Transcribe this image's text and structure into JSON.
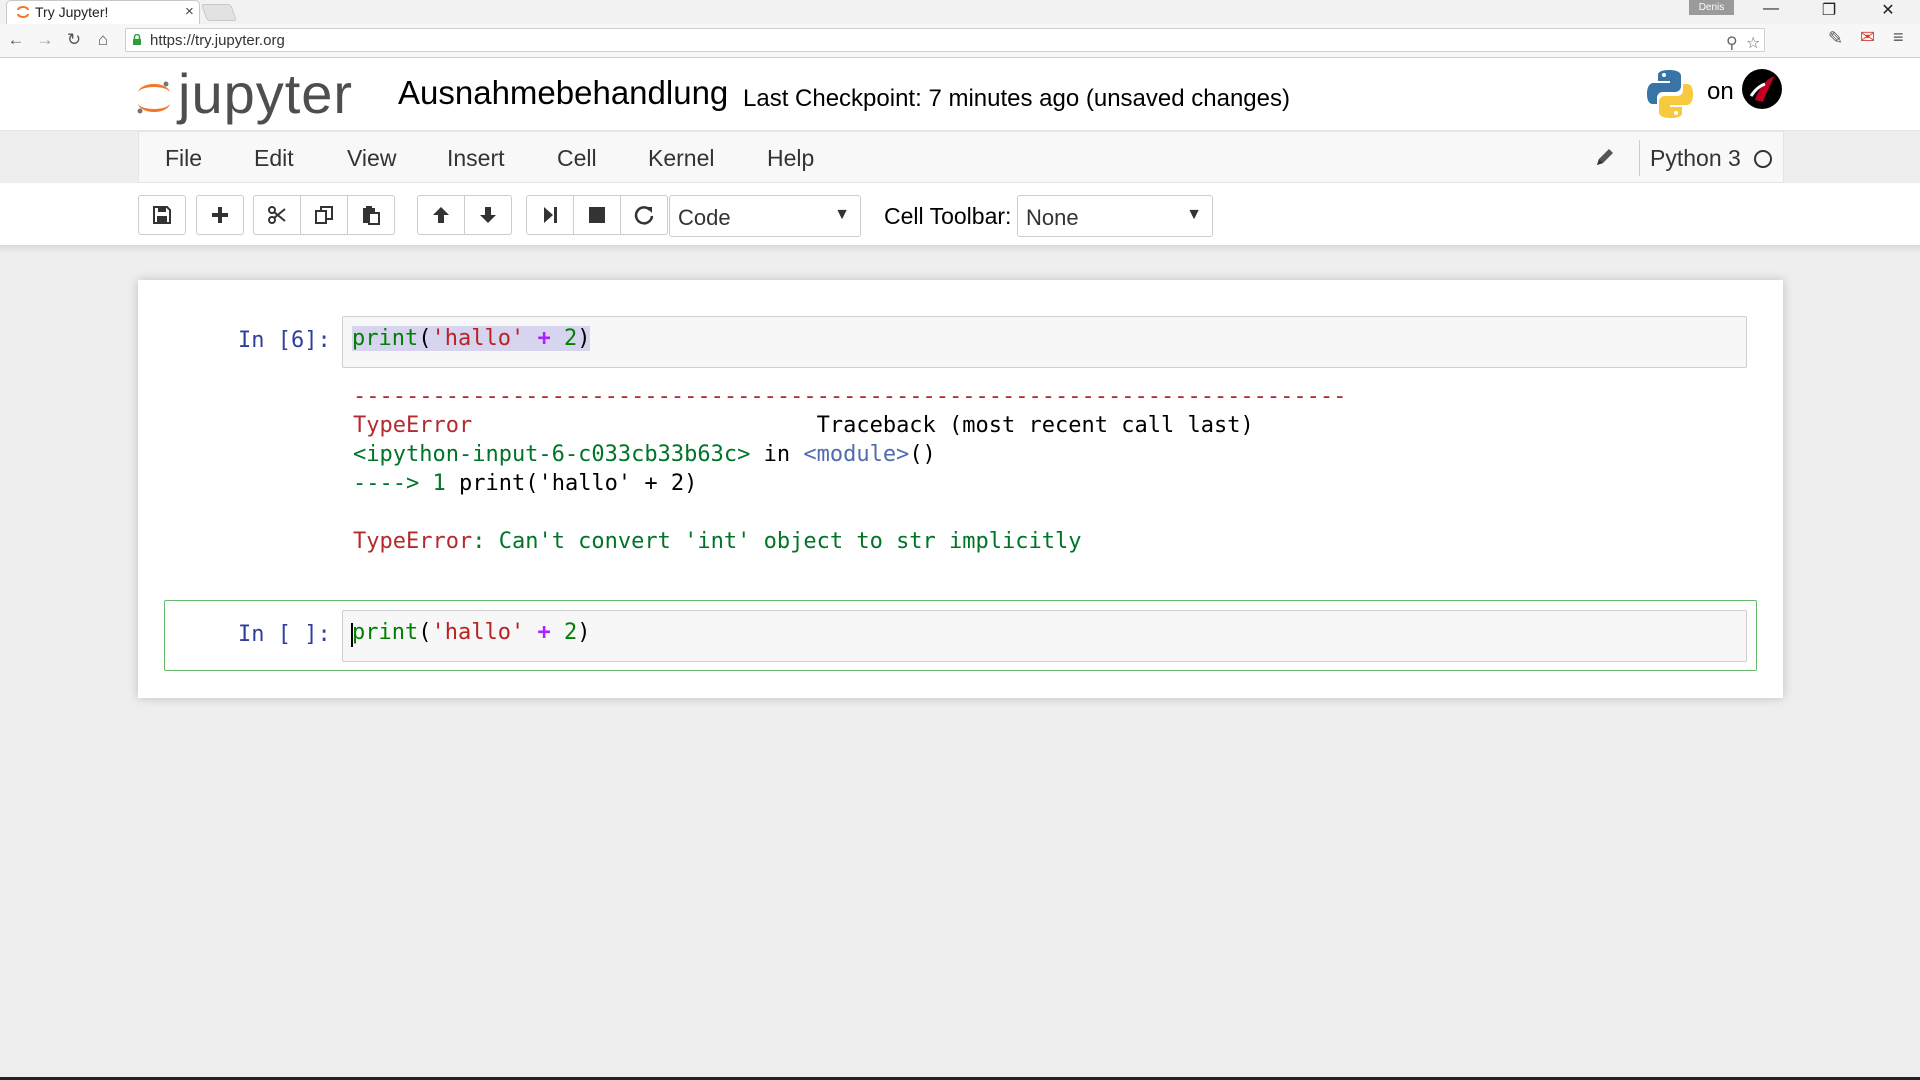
{
  "browser": {
    "tab_title": "Try Jupyter!",
    "tab_close": "×",
    "profile": "Denis",
    "url": "https://try.jupyter.org",
    "window_controls": [
      "—",
      "❐",
      "✕"
    ]
  },
  "header": {
    "logo_text": "jupyter",
    "notebook_title": "Ausnahmebehandlung",
    "checkpoint": "Last Checkpoint: 7 minutes ago (unsaved changes)",
    "on_label": "on"
  },
  "menubar": {
    "items": [
      "File",
      "Edit",
      "View",
      "Insert",
      "Cell",
      "Kernel",
      "Help"
    ],
    "kernel_name": "Python 3"
  },
  "toolbar": {
    "cell_type": "Code",
    "cell_toolbar_label": "Cell Toolbar:",
    "cell_toolbar_value": "None",
    "icons": [
      "save-icon",
      "plus-icon",
      "cut-icon",
      "copy-icon",
      "paste-icon",
      "arrow-up-icon",
      "arrow-down-icon",
      "step-forward-icon",
      "stop-icon",
      "restart-icon"
    ]
  },
  "cells": [
    {
      "prompt": "In [6]:",
      "code": {
        "fn": "print",
        "open": "(",
        "str": "'hallo'",
        "sp1": " ",
        "op": "+",
        "sp2": " ",
        "num": "2",
        "close": ")"
      },
      "output": {
        "dashes": "---------------------------------------------------------------------------",
        "err_type": "TypeError",
        "traceback_header": "Traceback (most recent call last)",
        "input_ref": "<ipython-input-6-c033cb33b63c>",
        "in_word": " in ",
        "module": "<module>",
        "parens": "()",
        "arrow": "----> 1 ",
        "line_fn": "print",
        "line_open": "(",
        "line_str": "'hallo'",
        "line_op": " + ",
        "line_num": "2",
        "line_close": ")",
        "err_name": "TypeError",
        "err_msg": ": Can't convert 'int' object to str implicitly"
      }
    },
    {
      "prompt": "In [ ]:",
      "code": {
        "fn": "print",
        "open": "(",
        "str": "'hallo'",
        "sp1": " ",
        "op": "+",
        "sp2": " ",
        "num": "2",
        "close": ")"
      }
    }
  ],
  "colors": {
    "prompt": "#303F9F",
    "selected_border": "#66bb6a",
    "error_red": "#B22B31",
    "accent_orange": "#F37726"
  }
}
